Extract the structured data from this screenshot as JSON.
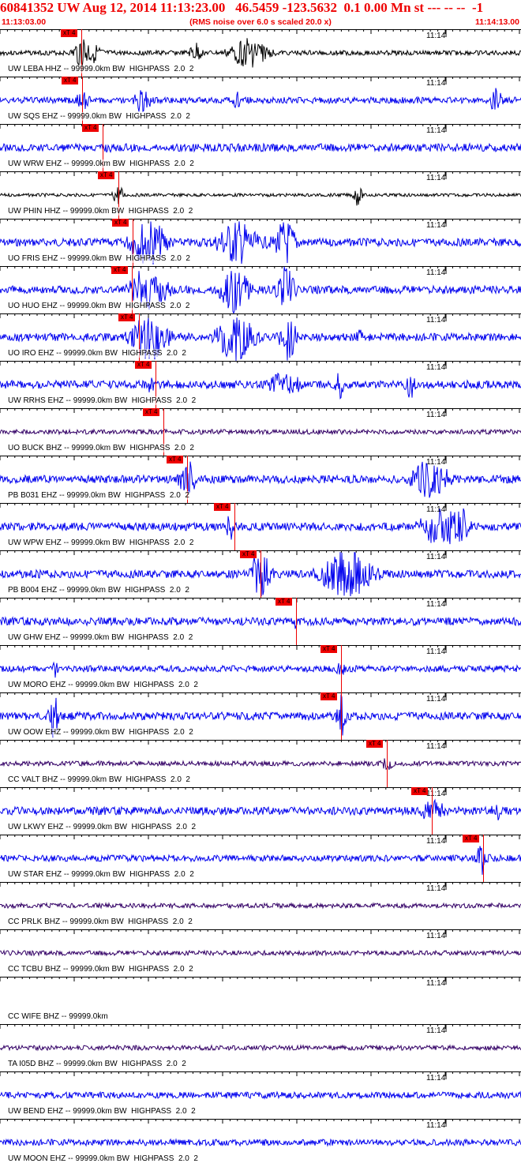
{
  "header": {
    "title": "60841352 UW Aug 12, 2014 11:13:23.00   46.5459 -123.5632  0.1 0.00 Mn st --- -- --  -1",
    "start_time": "11:13:03.00",
    "rms_note": "(RMS noise over 6.0 s scaled 20.0 x)",
    "end_time": "11:14:13.00"
  },
  "minute_tick_label": "11:14",
  "pick_label": "xT 4",
  "colors": {
    "header": "#ee0000",
    "pick": "#ee0000",
    "grid": "#000000"
  },
  "traces": [
    {
      "label": "UW LEBA HHZ -- 99999.0km BW  HIGHPASS  2.0  2",
      "color": "#000000",
      "pick": true
    },
    {
      "label": "UW SQS EHZ -- 99999.0km BW  HIGHPASS  2.0  2",
      "color": "#0000ee",
      "pick": true
    },
    {
      "label": "UW WRW EHZ -- 99999.0km BW  HIGHPASS  2.0  2",
      "color": "#0000ee",
      "pick": true
    },
    {
      "label": "UW PHIN HHZ -- 99999.0km BW  HIGHPASS  2.0  2",
      "color": "#000000",
      "pick": true
    },
    {
      "label": "UO FRIS EHZ -- 99999.0km BW  HIGHPASS  2.0  2",
      "color": "#0000ee",
      "pick": true
    },
    {
      "label": "UO HUO EHZ -- 99999.0km BW  HIGHPASS  2.0  2",
      "color": "#0000ee",
      "pick": true
    },
    {
      "label": "UO IRO EHZ -- 99999.0km BW  HIGHPASS  2.0  2",
      "color": "#0000ee",
      "pick": true
    },
    {
      "label": "UW RRHS EHZ -- 99999.0km BW  HIGHPASS  2.0  2",
      "color": "#0000ee",
      "pick": true
    },
    {
      "label": "UO BUCK BHZ -- 99999.0km BW  HIGHPASS  2.0  2",
      "color": "#330066",
      "pick": true
    },
    {
      "label": "PB B031 EHZ -- 99999.0km BW  HIGHPASS  2.0  2",
      "color": "#0000ee",
      "pick": true
    },
    {
      "label": "UW WPW EHZ -- 99999.0km BW  HIGHPASS  2.0  2",
      "color": "#0000ee",
      "pick": true
    },
    {
      "label": "PB B004 EHZ -- 99999.0km BW  HIGHPASS  2.0  2",
      "color": "#0000ee",
      "pick": true
    },
    {
      "label": "UW GHW EHZ -- 99999.0km BW  HIGHPASS  2.0  2",
      "color": "#0000ee",
      "pick": true
    },
    {
      "label": "UW MORO EHZ -- 99999.0km BW  HIGHPASS  2.0  2",
      "color": "#0000ee",
      "pick": true
    },
    {
      "label": "UW OOW EHZ -- 99999.0km BW  HIGHPASS  2.0  2",
      "color": "#0000ee",
      "pick": true
    },
    {
      "label": "CC VALT BHZ -- 99999.0km BW  HIGHPASS  2.0  2",
      "color": "#330066",
      "pick": true
    },
    {
      "label": "UW LKWY EHZ -- 99999.0km BW  HIGHPASS  2.0  2",
      "color": "#0000ee",
      "pick": true
    },
    {
      "label": "UW STAR EHZ -- 99999.0km BW  HIGHPASS  2.0  2",
      "color": "#0000ee",
      "pick": true
    },
    {
      "label": "CC PRLK BHZ -- 99999.0km BW  HIGHPASS  2.0  2",
      "color": "#330066",
      "pick": false
    },
    {
      "label": "CC TCBU BHZ -- 99999.0km BW  HIGHPASS  2.0  2",
      "color": "#330066",
      "pick": false
    },
    {
      "label": "CC WIFE BHZ -- 99999.0km",
      "color": "#330066",
      "pick": false
    },
    {
      "label": "TA I05D BHZ -- 99999.0km BW  HIGHPASS  2.0  2",
      "color": "#330066",
      "pick": false
    },
    {
      "label": "UW BEND EHZ -- 99999.0km BW  HIGHPASS  2.0  2",
      "color": "#0000ee",
      "pick": false
    },
    {
      "label": "UW MOON EHZ -- 99999.0km BW  HIGHPASS  2.0  2",
      "color": "#0000ee",
      "pick": false
    }
  ]
}
